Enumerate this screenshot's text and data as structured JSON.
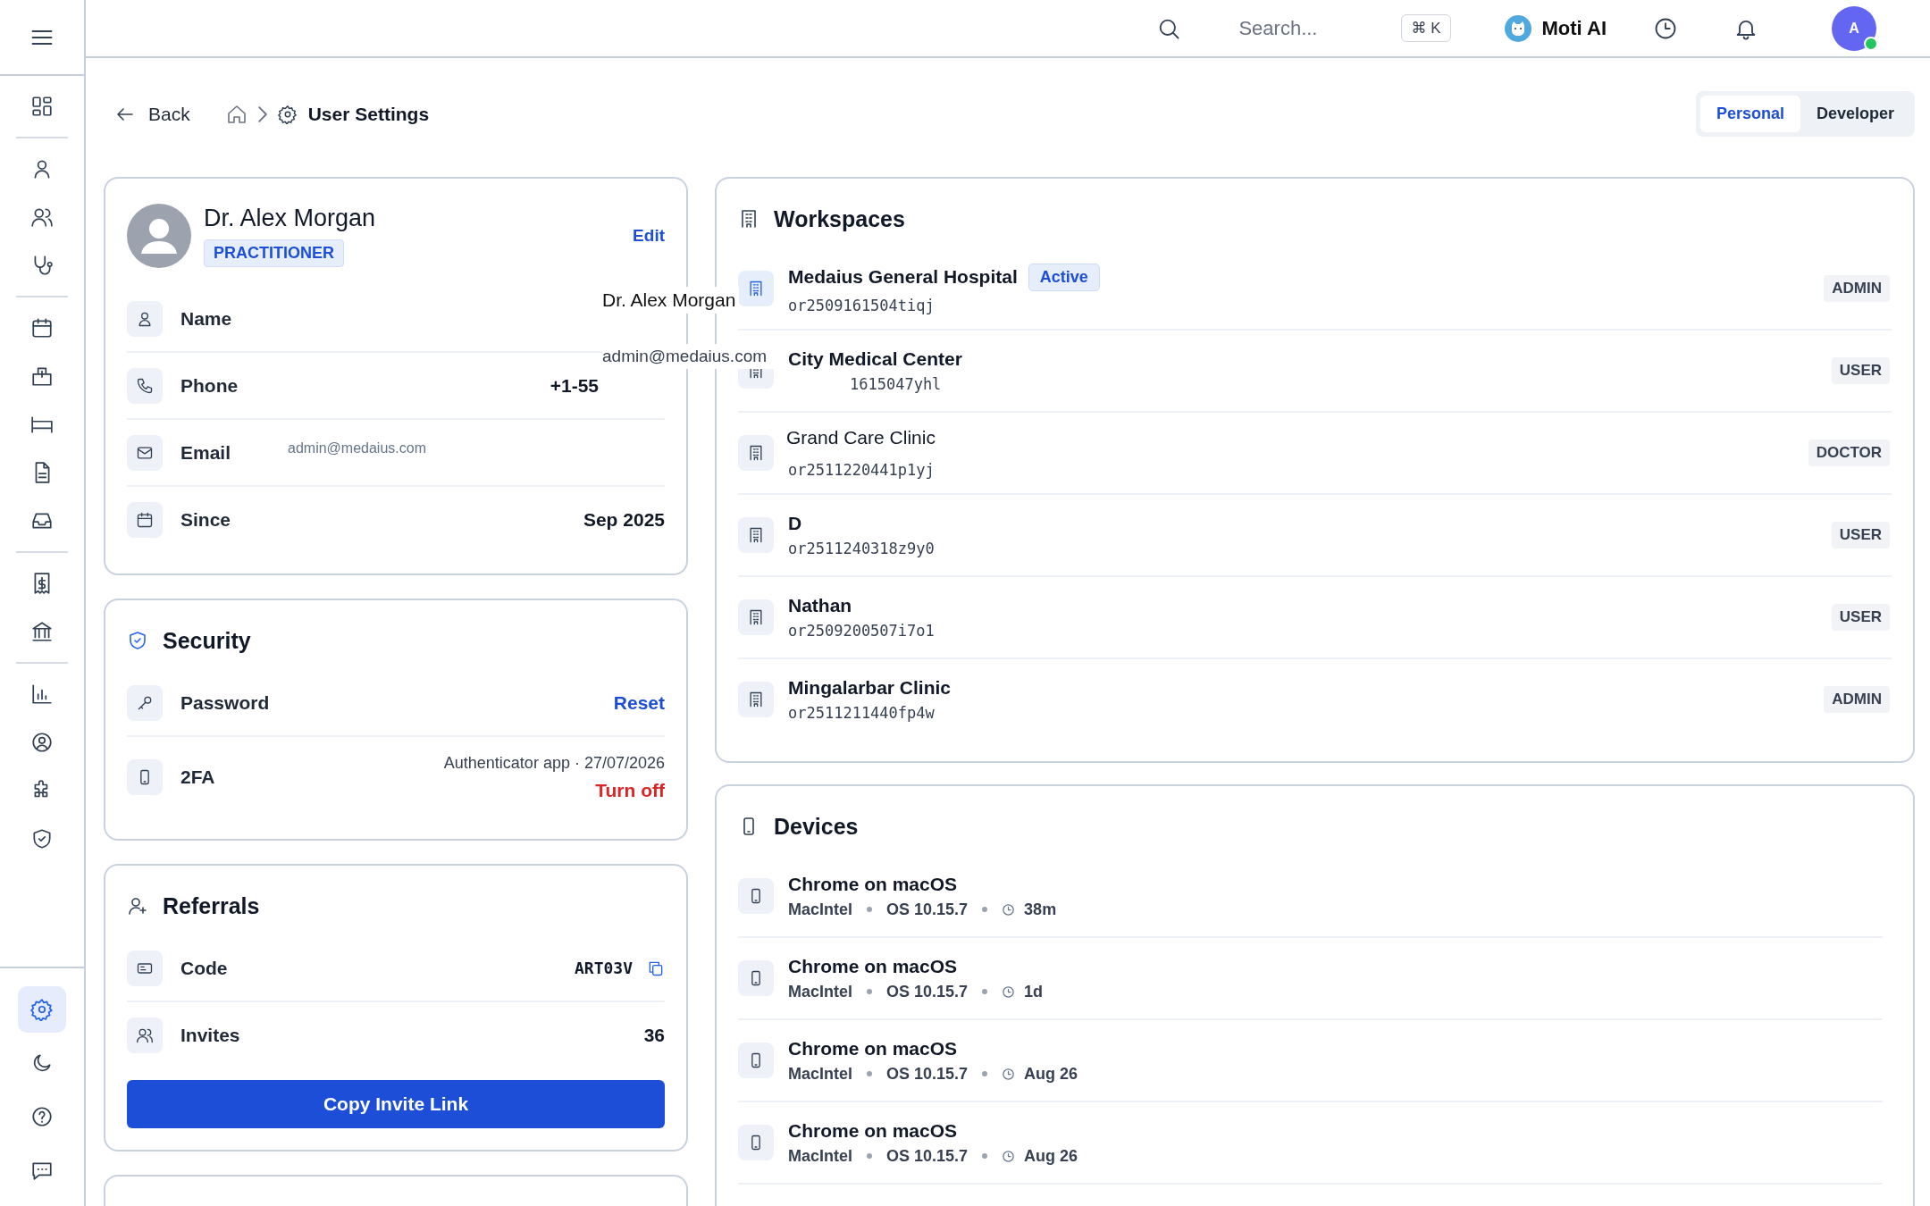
{
  "topbar": {
    "search_placeholder": "Search...",
    "shortcut": "⌘ K",
    "assistant": "Moti AI",
    "avatar": "A"
  },
  "sidebar": {
    "groups": [
      [
        {
          "selected": false
        }
      ],
      [
        {
          "selected": false
        },
        {
          "selected": false
        },
        {
          "selected": false
        }
      ],
      [
        {
          "selected": false
        },
        {
          "selected": false
        },
        {
          "selected": false
        },
        {
          "selected": false
        },
        {
          "selected": false
        }
      ],
      [
        {
          "selected": false
        },
        {
          "selected": false
        }
      ],
      [
        {
          "selected": false
        },
        {
          "selected": false
        },
        {
          "selected": false
        },
        {
          "selected": false
        }
      ]
    ],
    "bottom": [
      {
        "selected": true
      },
      {
        "selected": false
      },
      {
        "selected": false
      },
      {
        "selected": false
      }
    ]
  },
  "breadcrumb": {
    "back": "Back",
    "current": "User Settings"
  },
  "mode_tabs": [
    {
      "label": "Personal",
      "selected": true
    },
    {
      "label": "Developer",
      "selected": false
    }
  ],
  "profile": {
    "name": "Dr. Alex Morgan",
    "role": "PRACTITIONER",
    "edit": "Edit",
    "rows": [
      {
        "label": "Name",
        "kind": "empty"
      },
      {
        "label": "Phone",
        "kind": "cut",
        "value": "+1-55"
      },
      {
        "label": "Email",
        "kind": "inline",
        "value": "admin@medaius.com"
      },
      {
        "label": "Since",
        "kind": "value",
        "value": "Sep 2025"
      }
    ]
  },
  "floating_labels": [
    "Dr. Alex Morgan",
    "admin@medaius.com"
  ],
  "security": {
    "title": "Security",
    "rows": [
      {
        "label": "Password",
        "action": "Reset",
        "kind": "primary"
      },
      {
        "label": "2FA",
        "detail": "Authenticator app · 27/07/2026",
        "action": "Turn off",
        "kind": "danger"
      }
    ]
  },
  "referrals": {
    "title": "Referrals",
    "code_label": "Code",
    "code": "ART03V",
    "invites_label": "Invites",
    "invites": "36",
    "button": "Copy Invite Link"
  },
  "workspaces": {
    "title": "Workspaces",
    "items": [
      {
        "name": "Medaius General Hospital",
        "badge": "Active",
        "code": "or2509161504tiqj",
        "role": "ADMIN",
        "active": true,
        "kind": "bold"
      },
      {
        "name": "City Medical Center",
        "code": "1615047yhl",
        "role": "USER",
        "active": false,
        "kind": "covered"
      },
      {
        "name": "Grand Care Clinic",
        "code": "or2511220441p1yj",
        "role": "DOCTOR",
        "active": false,
        "kind": "plain"
      },
      {
        "name": "D",
        "code": "or2511240318z9y0",
        "role": "USER",
        "active": false,
        "kind": "bold"
      },
      {
        "name": "Nathan",
        "code": "or2509200507i7o1",
        "role": "USER",
        "active": false,
        "kind": "bold"
      },
      {
        "name": "Mingalarbar Clinic",
        "code": "or2511211440fp4w",
        "role": "ADMIN",
        "active": false,
        "kind": "bold"
      }
    ]
  },
  "devices": {
    "title": "Devices",
    "items": [
      {
        "name": "Chrome on macOS",
        "platform": "MacIntel",
        "os": "OS 10.15.7",
        "seen": "38m"
      },
      {
        "name": "Chrome on macOS",
        "platform": "MacIntel",
        "os": "OS 10.15.7",
        "seen": "1d"
      },
      {
        "name": "Chrome on macOS",
        "platform": "MacIntel",
        "os": "OS 10.15.7",
        "seen": "Aug 26"
      },
      {
        "name": "Chrome on macOS",
        "platform": "MacIntel",
        "os": "OS 10.15.7",
        "seen": "Aug 26"
      }
    ]
  }
}
